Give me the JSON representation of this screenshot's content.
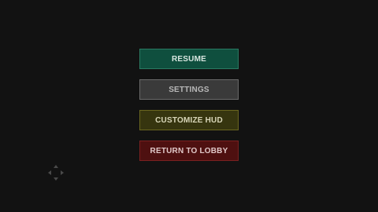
{
  "pause_menu": {
    "buttons": [
      {
        "label": "RESUME"
      },
      {
        "label": "SETTINGS"
      },
      {
        "label": "CUSTOMIZE HUD"
      },
      {
        "label": "RETURN TO LOBBY"
      }
    ]
  },
  "controls": {
    "dpad_icon": "dpad-icon"
  },
  "colors": {
    "background": "#121212",
    "resume": "#0f4f3e",
    "settings": "#3a3a3a",
    "customize_hud": "#36350f",
    "return_to_lobby": "#4e1010"
  }
}
